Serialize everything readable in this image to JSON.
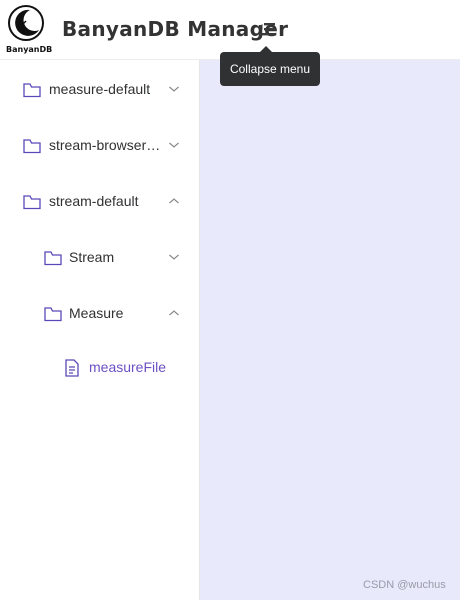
{
  "header": {
    "logo_text": "BanyanDB",
    "title": "BanyanDB Manager",
    "collapse_icon": "collapse-menu-icon",
    "tooltip": "Collapse menu"
  },
  "sidebar": {
    "items": [
      {
        "label": "measure-default",
        "icon": "folder-icon",
        "state": "collapsed"
      },
      {
        "label": "stream-browser…",
        "icon": "folder-icon",
        "state": "collapsed"
      },
      {
        "label": "stream-default",
        "icon": "folder-icon",
        "state": "expanded"
      },
      {
        "label": "Stream",
        "icon": "folder-icon",
        "state": "collapsed"
      },
      {
        "label": "Measure",
        "icon": "folder-icon",
        "state": "expanded"
      },
      {
        "label": "measureFile",
        "icon": "document-icon",
        "state": "active"
      }
    ]
  },
  "watermark": "CSDN @wuchus",
  "colors": {
    "accent": "#6b51c4",
    "content_bg": "#e8eafb",
    "tooltip_bg": "#303133"
  }
}
